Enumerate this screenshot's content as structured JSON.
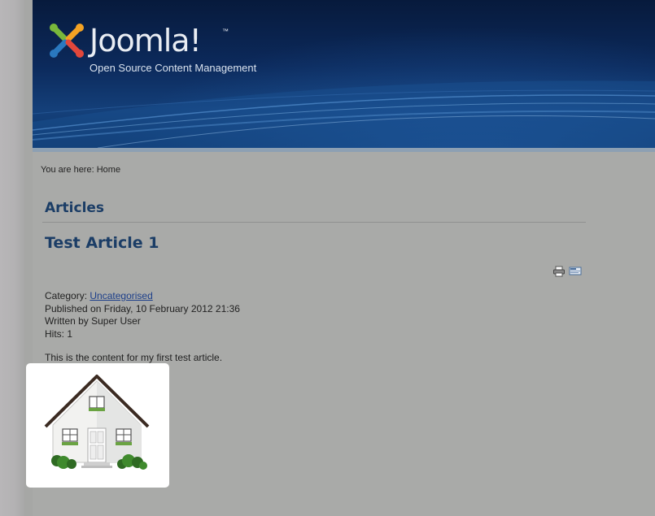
{
  "header": {
    "logo_text": "Joomla!",
    "logo_tm": "™",
    "tagline": "Open Source Content Management"
  },
  "breadcrumb": {
    "label": "You are here:",
    "current": "Home"
  },
  "section": {
    "title": "Articles"
  },
  "article": {
    "title": "Test Article 1",
    "category_label": "Category:",
    "category_value": "Uncategorised",
    "published": "Published on Friday, 10 February 2012 21:36",
    "author": "Written by Super User",
    "hits": "Hits: 1",
    "body": "This is the content for my first test article."
  },
  "icons": {
    "print": "print-icon",
    "email": "email-icon"
  },
  "colors": {
    "page_bg": "#a9aaa8",
    "header_dark": "#071a3c",
    "title_blue": "#1b3d66",
    "link_blue": "#1d3f8a"
  }
}
